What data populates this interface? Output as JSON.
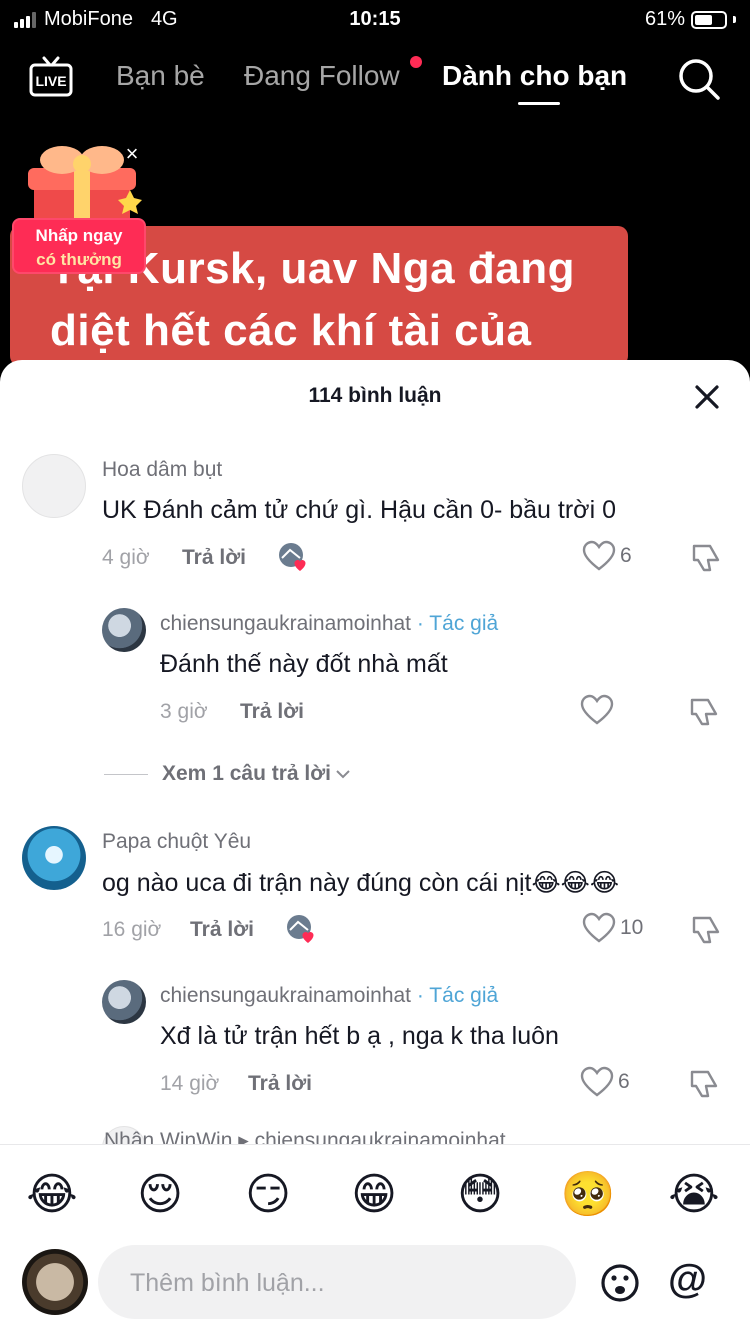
{
  "status_bar": {
    "carrier": "MobiFone",
    "network": "4G",
    "time": "10:15",
    "battery": "61%",
    "battery_level": 0.61
  },
  "nav": {
    "tabs": [
      {
        "label": "Bạn bè"
      },
      {
        "label": "Đang Follow"
      },
      {
        "label": "Dành cho bạn"
      }
    ],
    "active_tab": "Dành cho bạn",
    "live_label": "LIVE"
  },
  "video": {
    "caption_line1": "Tại Kursk, uav Nga đang",
    "caption_line2": "diệt hết các khí tài của"
  },
  "promo": {
    "line1": "Nhấp ngay",
    "line2": "có thưởng"
  },
  "comments_sheet": {
    "title": "114 bình luận",
    "comments": [
      {
        "user": "Hoa dâm bụt",
        "text": "UK Đánh cảm tử chứ gì. Hậu cần 0- bầu trời 0",
        "time": "4 giờ",
        "reply_label": "Trả lời",
        "likes": "6",
        "replies": [
          {
            "user": "chiensungaukrainamoinhat",
            "author_tag": "· Tác giả",
            "text": "Đánh thế này đốt nhà mất",
            "time": "3 giờ",
            "reply_label": "Trả lời",
            "likes": ""
          }
        ],
        "more_replies": "Xem 1 câu trả lời"
      },
      {
        "user": "Papa chuột Yêu",
        "text": "og nào uca đi trận này đúng còn cái nịt😂😂😂",
        "time": "16 giờ",
        "reply_label": "Trả lời",
        "likes": "10",
        "replies": [
          {
            "user": "chiensungaukrainamoinhat",
            "author_tag": "· Tác giả",
            "text": "Xđ là tử trận hết b ạ , nga k tha luôn",
            "time": "14 giờ",
            "reply_label": "Trả lời",
            "likes": "6"
          }
        ]
      }
    ],
    "peek": "Nhân WinWin ▸ chiensungaukrainamoinhat"
  },
  "composer": {
    "emojis": [
      "😂",
      "😌",
      "😏",
      "😁",
      "😳",
      "🥺",
      "😭"
    ],
    "placeholder": "Thêm bình luận...",
    "at_symbol": "@"
  }
}
